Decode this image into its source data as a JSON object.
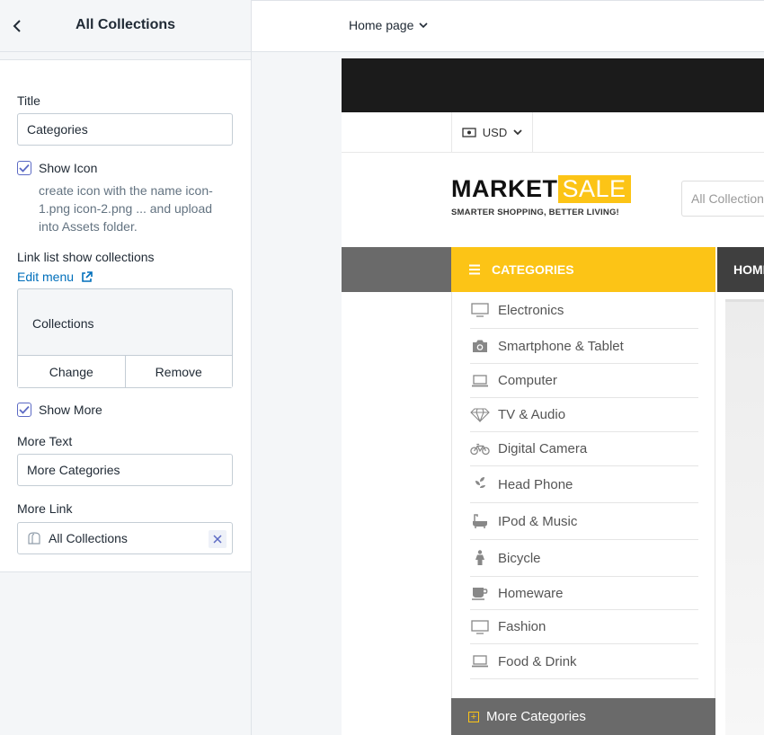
{
  "panel": {
    "title": "All Collections",
    "fields": {
      "title_label": "Title",
      "title_value": "Categories",
      "show_icon_label": "Show Icon",
      "show_icon_checked": true,
      "show_icon_help": "create icon with the name icon-1.png icon-2.png ... and upload into Assets folder.",
      "link_list_label": "Link list show collections",
      "edit_menu_label": "Edit menu",
      "collection_name": "Collections",
      "change_label": "Change",
      "remove_label": "Remove",
      "show_more_label": "Show More",
      "show_more_checked": true,
      "more_text_label": "More Text",
      "more_text_value": "More Categories",
      "more_link_label": "More Link",
      "more_link_value": "All Collections"
    }
  },
  "topbar": {
    "page_select": "Home page"
  },
  "preview": {
    "currency": "USD",
    "logo_market": "MARKET",
    "logo_sale": "SALE",
    "logo_tagline": "SMARTER SHOPPING, BETTER LIVING!",
    "search_placeholder": "All Collection",
    "categories_header": "CATEGORIES",
    "nav_home": "HOME",
    "categories": [
      {
        "label": "Electronics",
        "icon": "monitor-icon"
      },
      {
        "label": "Smartphone & Tablet",
        "icon": "camera-icon"
      },
      {
        "label": "Computer",
        "icon": "laptop-icon"
      },
      {
        "label": "TV & Audio",
        "icon": "diamond-icon"
      },
      {
        "label": "Digital Camera",
        "icon": "bicycle-icon"
      },
      {
        "label": "Head Phone",
        "icon": "leaf-icon"
      },
      {
        "label": "IPod & Music",
        "icon": "bathtub-icon"
      },
      {
        "label": "Bicycle",
        "icon": "person-icon"
      },
      {
        "label": "Homeware",
        "icon": "coffee-cup-icon"
      },
      {
        "label": "Fashion",
        "icon": "monitor-icon"
      },
      {
        "label": "Food & Drink",
        "icon": "laptop-icon"
      }
    ],
    "more_categories": "More Categories"
  },
  "colors": {
    "accent": "#fcc416",
    "nav_gray": "#6a6a6a",
    "link_blue": "#006fbb",
    "checkbox": "#5c6ac4"
  }
}
